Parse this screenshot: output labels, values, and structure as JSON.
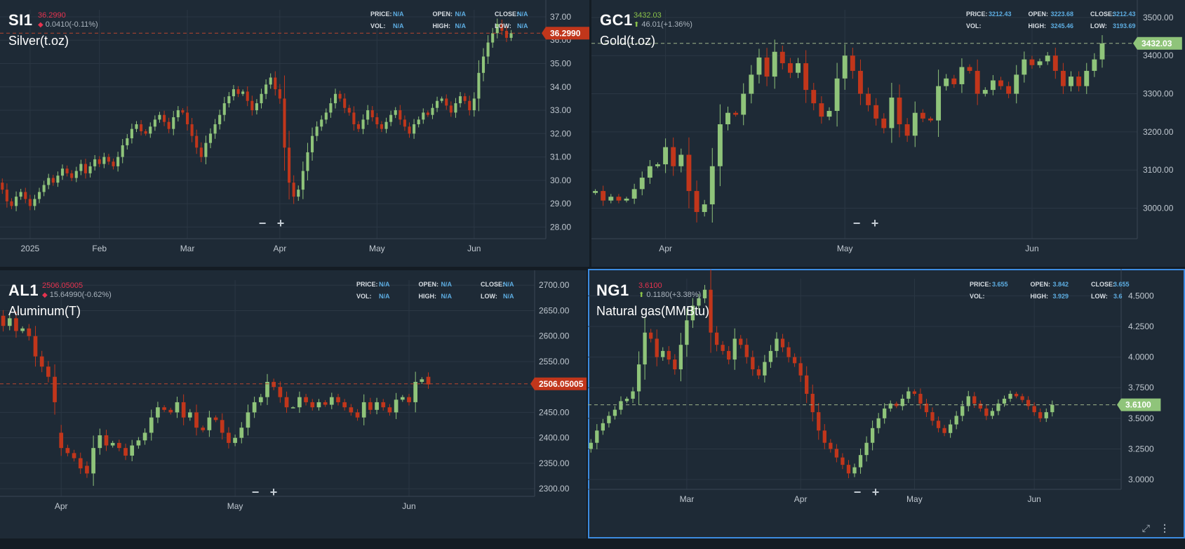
{
  "colors": {
    "up": "#8fc47a",
    "down": "#c1361b",
    "grid": "#2b3744",
    "axis_text": "#c0c8d0",
    "price_red": "#e6334f",
    "price_green": "#8bc34a",
    "stat_value": "#5dade2"
  },
  "icons": {
    "down_arrow": "◆",
    "up_arrow": "⬆",
    "zoom_out": "−",
    "zoom_in": "+",
    "expand": "⤢",
    "more": "⋮"
  },
  "panels": [
    {
      "symbol": "SI1",
      "price": "36.2990",
      "direction": "down",
      "change": "0.0410(-0.11%)",
      "name": "Silver(t.oz)",
      "stats": {
        "price_label": "PRICE:",
        "price": "N/A",
        "open_label": "OPEN:",
        "open": "N/A",
        "close_label": "CLOSE:",
        "close": "N/A",
        "vol_label": "VOL:",
        "vol": "N/A",
        "high_label": "HIGH:",
        "high": "N/A",
        "low_label": "LOW:",
        "low": "N/A"
      },
      "last_label": "36.2990",
      "active": false
    },
    {
      "symbol": "GC1",
      "price": "3432.03",
      "direction": "up",
      "change": "46.01(+1.36%)",
      "name": "Gold(t.oz)",
      "stats": {
        "price_label": "PRICE:",
        "price": "3212.43",
        "open_label": "OPEN:",
        "open": "3223.68",
        "close_label": "CLOSE:",
        "close": "3212.43",
        "vol_label": "VOL:",
        "vol": "",
        "high_label": "HIGH:",
        "high": "3245.46",
        "low_label": "LOW:",
        "low": "3193.69"
      },
      "last_label": "3432.03",
      "active": false
    },
    {
      "symbol": "AL1",
      "price": "2506.05005",
      "direction": "down",
      "change": "15.64990(-0.62%)",
      "name": "Aluminum(T)",
      "stats": {
        "price_label": "PRICE:",
        "price": "N/A",
        "open_label": "OPEN:",
        "open": "N/A",
        "close_label": "CLOSE:",
        "close": "N/A",
        "vol_label": "VOL:",
        "vol": "N/A",
        "high_label": "HIGH:",
        "high": "N/A",
        "low_label": "LOW:",
        "low": "N/A"
      },
      "last_label": "2506.05005",
      "active": false
    },
    {
      "symbol": "NG1",
      "price": "3.6100",
      "direction": "up",
      "change": "0.1180(+3.38%)",
      "name": "Natural gas(MMBtu)",
      "stats": {
        "price_label": "PRICE:",
        "price": "3.655",
        "open_label": "OPEN:",
        "open": "3.842",
        "close_label": "CLOSE:",
        "close": "3.655",
        "vol_label": "VOL:",
        "vol": "",
        "high_label": "HIGH:",
        "high": "3.929",
        "low_label": "LOW:",
        "low": "3.6"
      },
      "last_label": "3.6100",
      "active": true
    }
  ],
  "chart_data": [
    {
      "type": "candlestick",
      "title": "Silver(t.oz)",
      "ylim": [
        27.5,
        37.3
      ],
      "y_ticks": [
        28,
        29,
        30,
        31,
        32,
        33,
        34,
        35,
        36,
        37
      ],
      "y_tick_labels": [
        "28.00",
        "29.00",
        "30.00",
        "31.00",
        "32.00",
        "33.00",
        "34.00",
        "35.00",
        "36.00",
        "37.00"
      ],
      "x_ticks": [
        {
          "label": "2025",
          "i": 6
        },
        {
          "label": "Feb",
          "i": 21
        },
        {
          "label": "Mar",
          "i": 40
        },
        {
          "label": "Apr",
          "i": 60
        },
        {
          "label": "May",
          "i": 81
        },
        {
          "label": "Jun",
          "i": 102
        }
      ],
      "x_count": 118,
      "last_price": 36.299,
      "close": [
        29.6,
        29.1,
        28.9,
        29.3,
        29.5,
        29.2,
        28.9,
        29.2,
        29.5,
        29.8,
        30.1,
        29.9,
        30.2,
        30.5,
        30.3,
        30.1,
        30.4,
        30.7,
        30.3,
        30.6,
        30.9,
        30.7,
        31.0,
        30.8,
        30.6,
        31.0,
        31.5,
        31.8,
        32.2,
        32.4,
        32.1,
        32.0,
        32.3,
        32.6,
        32.8,
        32.5,
        32.2,
        32.7,
        33.0,
        32.9,
        32.4,
        31.9,
        31.4,
        31.0,
        31.6,
        32.0,
        32.4,
        32.8,
        33.3,
        33.6,
        33.9,
        33.7,
        33.8,
        33.4,
        33.0,
        33.3,
        33.7,
        34.1,
        34.4,
        33.9,
        33.5,
        31.4,
        29.9,
        29.3,
        29.6,
        30.4,
        31.2,
        31.9,
        32.3,
        32.6,
        32.9,
        33.3,
        33.7,
        33.5,
        33.1,
        32.9,
        32.4,
        32.2,
        32.6,
        33.0,
        32.7,
        32.4,
        32.2,
        32.5,
        32.8,
        33.0,
        32.6,
        32.3,
        32.0,
        32.4,
        32.6,
        32.9,
        32.8,
        33.1,
        33.4,
        33.5,
        33.2,
        32.9,
        33.3,
        33.6,
        33.4,
        33.0,
        33.5,
        34.6,
        35.3,
        35.9,
        36.3,
        36.7,
        36.4,
        36.1,
        36.3
      ],
      "open": [
        29.9,
        29.6,
        29.1,
        28.9,
        29.3,
        29.5,
        29.2,
        28.9,
        29.2,
        29.5,
        29.8,
        30.1,
        29.9,
        30.2,
        30.5,
        30.3,
        30.1,
        30.4,
        30.7,
        30.3,
        30.6,
        30.9,
        30.7,
        31.0,
        30.8,
        30.6,
        31.0,
        31.5,
        31.8,
        32.2,
        32.4,
        32.1,
        32.0,
        32.3,
        32.6,
        32.8,
        32.5,
        32.2,
        32.7,
        33.0,
        32.9,
        32.4,
        31.9,
        31.4,
        31.0,
        31.6,
        32.0,
        32.4,
        32.8,
        33.3,
        33.6,
        33.9,
        33.7,
        33.8,
        33.4,
        33.0,
        33.3,
        33.7,
        34.1,
        34.4,
        33.9,
        33.5,
        31.4,
        29.9,
        29.3,
        29.6,
        30.4,
        31.2,
        31.9,
        32.3,
        32.6,
        32.9,
        33.3,
        33.7,
        33.5,
        33.1,
        32.9,
        32.4,
        32.2,
        32.6,
        33.0,
        32.7,
        32.4,
        32.2,
        32.5,
        32.8,
        33.0,
        32.6,
        32.3,
        32.0,
        32.4,
        32.6,
        32.9,
        32.8,
        33.1,
        33.4,
        33.5,
        33.2,
        32.9,
        33.3,
        33.6,
        33.4,
        33.0,
        33.5,
        34.6,
        35.3,
        35.9,
        36.3,
        36.7,
        36.4,
        36.1
      ]
    },
    {
      "type": "candlestick",
      "title": "Gold(t.oz)",
      "ylim": [
        2920,
        3520
      ],
      "y_ticks": [
        3000,
        3100,
        3200,
        3300,
        3400,
        3500
      ],
      "y_tick_labels": [
        "3000.00",
        "3100.00",
        "3200.00",
        "3300.00",
        "3400.00",
        "3500.00"
      ],
      "x_ticks": [
        {
          "label": "Apr",
          "i": 9
        },
        {
          "label": "May",
          "i": 32
        },
        {
          "label": "Jun",
          "i": 56
        }
      ],
      "x_count": 70,
      "last_price": 3432.03,
      "close": [
        3045,
        3020,
        3030,
        3020,
        3025,
        3050,
        3080,
        3110,
        3115,
        3160,
        3110,
        3140,
        3045,
        2990,
        3010,
        3110,
        3220,
        3250,
        3245,
        3300,
        3350,
        3395,
        3345,
        3410,
        3380,
        3355,
        3380,
        3310,
        3275,
        3240,
        3255,
        3340,
        3400,
        3360,
        3300,
        3270,
        3235,
        3210,
        3290,
        3220,
        3190,
        3250,
        3235,
        3230,
        3320,
        3340,
        3325,
        3370,
        3360,
        3300,
        3310,
        3335,
        3320,
        3300,
        3350,
        3390,
        3375,
        3385,
        3400,
        3360,
        3320,
        3345,
        3320,
        3360,
        3390,
        3432
      ],
      "open": [
        3040,
        3045,
        3020,
        3030,
        3020,
        3025,
        3050,
        3080,
        3110,
        3115,
        3160,
        3110,
        3140,
        3045,
        2990,
        3010,
        3110,
        3220,
        3250,
        3245,
        3300,
        3350,
        3395,
        3345,
        3410,
        3380,
        3355,
        3380,
        3310,
        3275,
        3240,
        3255,
        3340,
        3400,
        3360,
        3300,
        3270,
        3235,
        3210,
        3290,
        3220,
        3190,
        3250,
        3235,
        3230,
        3320,
        3340,
        3325,
        3370,
        3360,
        3300,
        3310,
        3335,
        3320,
        3300,
        3350,
        3390,
        3375,
        3385,
        3400,
        3360,
        3320,
        3345,
        3320,
        3360,
        3390
      ]
    },
    {
      "type": "candlestick",
      "title": "Aluminum(T)",
      "ylim": [
        2285,
        2710
      ],
      "y_ticks": [
        2300,
        2350,
        2400,
        2450,
        2500,
        2550,
        2600,
        2650,
        2700
      ],
      "y_tick_labels": [
        "2300.00",
        "2350.00",
        "2400.00",
        "2450.00",
        "2500.00",
        "2550.00",
        "2600.00",
        "2650.00",
        "2700.00"
      ],
      "x_ticks": [
        {
          "label": "Apr",
          "i": 9
        },
        {
          "label": "May",
          "i": 36
        },
        {
          "label": "Jun",
          "i": 63
        }
      ],
      "x_count": 83,
      "last_price": 2506.05,
      "close": [
        2620,
        2635,
        2610,
        2615,
        2600,
        2560,
        2540,
        2520,
        2470,
        2380,
        2370,
        2360,
        2340,
        2330,
        2380,
        2405,
        2385,
        2390,
        2380,
        2365,
        2385,
        2395,
        2410,
        2440,
        2460,
        2455,
        2450,
        2470,
        2440,
        2450,
        2420,
        2415,
        2440,
        2435,
        2410,
        2390,
        2400,
        2420,
        2450,
        2470,
        2480,
        2510,
        2500,
        2480,
        2460,
        2460,
        2480,
        2470,
        2460,
        2470,
        2465,
        2480,
        2470,
        2460,
        2450,
        2440,
        2470,
        2455,
        2470,
        2460,
        2450,
        2475,
        2480,
        2470,
        2510,
        2515,
        2505
      ],
      "open": [
        2640,
        2620,
        2635,
        2610,
        2615,
        2600,
        2560,
        2540,
        2520,
        2410,
        2380,
        2370,
        2360,
        2345,
        2330,
        2380,
        2405,
        2385,
        2390,
        2380,
        2365,
        2385,
        2395,
        2410,
        2440,
        2460,
        2455,
        2450,
        2470,
        2440,
        2450,
        2420,
        2415,
        2440,
        2435,
        2410,
        2390,
        2400,
        2420,
        2450,
        2470,
        2480,
        2510,
        2500,
        2480,
        2460,
        2460,
        2480,
        2470,
        2460,
        2470,
        2465,
        2480,
        2470,
        2460,
        2450,
        2440,
        2470,
        2455,
        2470,
        2460,
        2450,
        2475,
        2480,
        2470,
        2510,
        2520
      ]
    },
    {
      "type": "candlestick",
      "title": "Natural gas(MMBtu)",
      "ylim": [
        2.92,
        4.64
      ],
      "y_ticks": [
        3.0,
        3.25,
        3.5,
        3.75,
        4.0,
        4.25,
        4.5
      ],
      "y_tick_labels": [
        "3.0000",
        "3.2500",
        "3.5000",
        "3.7500",
        "4.0000",
        "4.2500",
        "4.5000"
      ],
      "x_ticks": [
        {
          "label": "Mar",
          "i": 16
        },
        {
          "label": "Apr",
          "i": 35
        },
        {
          "label": "May",
          "i": 54
        },
        {
          "label": "Jun",
          "i": 74
        }
      ],
      "x_count": 89,
      "last_price": 3.61,
      "close": [
        3.3,
        3.4,
        3.46,
        3.52,
        3.57,
        3.64,
        3.66,
        3.72,
        3.94,
        4.2,
        4.15,
        4.0,
        4.05,
        3.98,
        3.9,
        4.1,
        4.3,
        4.42,
        4.48,
        4.55,
        4.2,
        4.1,
        4.05,
        3.98,
        4.15,
        4.1,
        4.0,
        3.9,
        3.85,
        3.96,
        4.05,
        4.15,
        4.08,
        4.0,
        3.95,
        3.85,
        3.7,
        3.55,
        3.4,
        3.3,
        3.25,
        3.18,
        3.12,
        3.05,
        3.1,
        3.2,
        3.3,
        3.42,
        3.5,
        3.58,
        3.62,
        3.6,
        3.66,
        3.72,
        3.7,
        3.62,
        3.55,
        3.48,
        3.42,
        3.38,
        3.45,
        3.52,
        3.6,
        3.68,
        3.62,
        3.58,
        3.52,
        3.56,
        3.62,
        3.66,
        3.7,
        3.68,
        3.65,
        3.6,
        3.55,
        3.5,
        3.55,
        3.61
      ],
      "open": [
        3.25,
        3.3,
        3.4,
        3.46,
        3.52,
        3.57,
        3.64,
        3.66,
        3.72,
        3.94,
        4.2,
        4.15,
        4.0,
        4.05,
        3.98,
        3.9,
        4.1,
        4.3,
        4.42,
        4.48,
        4.55,
        4.2,
        4.1,
        4.05,
        3.98,
        4.15,
        4.1,
        4.0,
        3.9,
        3.85,
        3.96,
        4.05,
        4.15,
        4.08,
        4.0,
        3.95,
        3.85,
        3.7,
        3.55,
        3.4,
        3.3,
        3.25,
        3.18,
        3.12,
        3.05,
        3.1,
        3.2,
        3.3,
        3.42,
        3.5,
        3.58,
        3.62,
        3.6,
        3.66,
        3.72,
        3.7,
        3.62,
        3.55,
        3.48,
        3.42,
        3.38,
        3.45,
        3.52,
        3.6,
        3.68,
        3.62,
        3.58,
        3.52,
        3.56,
        3.62,
        3.66,
        3.7,
        3.68,
        3.65,
        3.6,
        3.55,
        3.5,
        3.55
      ]
    }
  ]
}
